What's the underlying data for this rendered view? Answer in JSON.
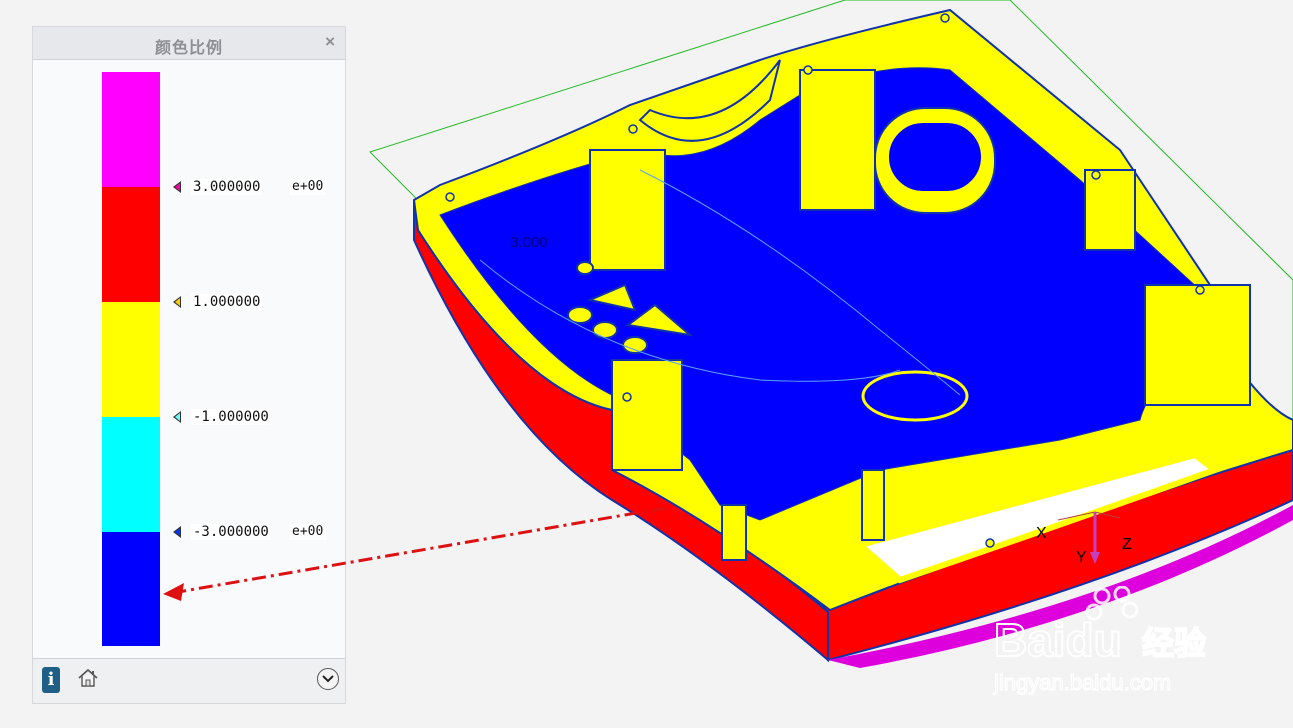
{
  "panel": {
    "title": "颜色比例",
    "close_label": "×",
    "scale": [
      {
        "color": "#ff00ff"
      },
      {
        "color": "#ff0000"
      },
      {
        "color": "#ffff00"
      },
      {
        "color": "#00ffff"
      },
      {
        "color": "#0000ff"
      }
    ],
    "labels": [
      {
        "value": "3.000000",
        "exponent": "e+00",
        "marker_color": "#ff00aa"
      },
      {
        "value": "1.000000",
        "exponent": "",
        "marker_color": "#ffcc00"
      },
      {
        "value": "-1.000000",
        "exponent": "",
        "marker_color": "#66ffff"
      },
      {
        "value": "-3.000000",
        "exponent": "e+00",
        "marker_color": "#0033ff"
      }
    ],
    "footer": {
      "info_icon": "info-icon",
      "home_icon": "home-icon",
      "more_icon": "chevron-down-icon"
    }
  },
  "viewport": {
    "annotation": "3.000",
    "axes": {
      "x": "X",
      "y": "Y",
      "z": "Z"
    },
    "colors": {
      "draft_positive": "#ff0000",
      "draft_neutral": "#ffff00",
      "draft_negative": "#0000ff",
      "bounding": "#22bb22"
    }
  },
  "watermark": {
    "brand": "Baidu",
    "brand_cn": "经验",
    "url": "jingyan.baidu.com"
  }
}
